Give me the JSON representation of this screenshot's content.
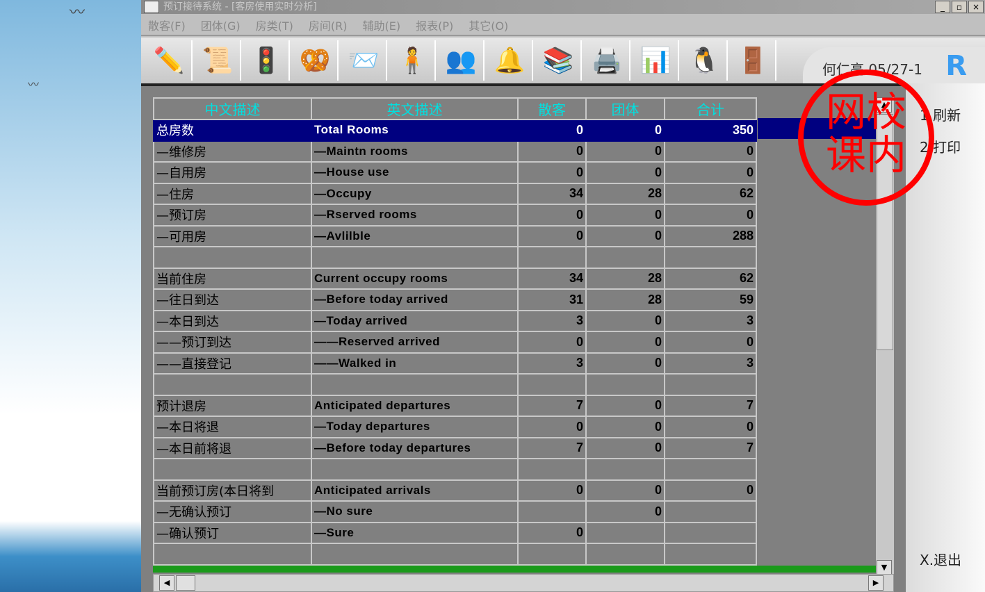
{
  "window": {
    "title": "预订接待系统 - [客房使用实时分析]",
    "min": "_",
    "restore": "▫",
    "close": "×"
  },
  "menu": [
    "散客(F)",
    "团体(G)",
    "房类(T)",
    "房间(R)",
    "辅助(E)",
    "报表(P)",
    "其它(O)"
  ],
  "toolbar": [
    {
      "icon": "pencil-icon",
      "glyph": "✏️"
    },
    {
      "icon": "scroll-icon",
      "glyph": "📜"
    },
    {
      "icon": "traffic-light-icon",
      "glyph": "🚦"
    },
    {
      "icon": "pretzel-icon",
      "glyph": "🥨"
    },
    {
      "icon": "mail-icon",
      "glyph": "📨"
    },
    {
      "icon": "person-icon",
      "glyph": "🧍"
    },
    {
      "icon": "group-icon",
      "glyph": "👥"
    },
    {
      "icon": "bell-icon",
      "glyph": "🔔"
    },
    {
      "icon": "books-icon",
      "glyph": "📚"
    },
    {
      "icon": "printer-icon",
      "glyph": "🖨️"
    },
    {
      "icon": "chart-icon",
      "glyph": "📊"
    },
    {
      "icon": "penguin-icon",
      "glyph": "🐧"
    },
    {
      "icon": "exit-door-icon",
      "glyph": "🚪"
    }
  ],
  "user": {
    "label": "何仁亮 05/27-1",
    "logo": "R"
  },
  "side": {
    "refresh": "1.刷新",
    "print": "2.打印",
    "exit": "X.退出"
  },
  "stamp": "网校课内",
  "table": {
    "headers": [
      "中文描述",
      "英文描述",
      "散客",
      "团体",
      "合计"
    ],
    "rows": [
      [
        "总房数",
        "Total Rooms",
        "0",
        "0",
        "350"
      ],
      [
        "—维修房",
        "—Maintn rooms",
        "0",
        "0",
        "0"
      ],
      [
        "—自用房",
        "—House use",
        "0",
        "0",
        "0"
      ],
      [
        "—住房",
        "—Occupy",
        "34",
        "28",
        "62"
      ],
      [
        "—预订房",
        "—Rserved rooms",
        "0",
        "0",
        "0"
      ],
      [
        "—可用房",
        "—Avlilble",
        "0",
        "0",
        "288"
      ],
      [
        "",
        "",
        "",
        "",
        ""
      ],
      [
        "当前住房",
        "Current occupy rooms",
        "34",
        "28",
        "62"
      ],
      [
        "—往日到达",
        "—Before today arrived",
        "31",
        "28",
        "59"
      ],
      [
        "—本日到达",
        "—Today arrived",
        "3",
        "0",
        "3"
      ],
      [
        "——预订到达",
        "——Reserved arrived",
        "0",
        "0",
        "0"
      ],
      [
        "——直接登记",
        "——Walked in",
        "3",
        "0",
        "3"
      ],
      [
        "",
        "",
        "",
        "",
        ""
      ],
      [
        "预计退房",
        "Anticipated departures",
        "7",
        "0",
        "7"
      ],
      [
        "—本日将退",
        "—Today departures",
        "0",
        "0",
        "0"
      ],
      [
        "—本日前将退",
        "—Before today departures",
        "7",
        "0",
        "7"
      ],
      [
        "",
        "",
        "",
        "",
        ""
      ],
      [
        "当前预订房(本日将到",
        "Anticipated arrivals",
        "0",
        "0",
        "0"
      ],
      [
        "—无确认预订",
        "—No sure",
        "",
        "0",
        ""
      ],
      [
        "—确认预订",
        "—Sure",
        "0",
        "",
        ""
      ],
      [
        "",
        "",
        "",
        "",
        ""
      ]
    ]
  }
}
